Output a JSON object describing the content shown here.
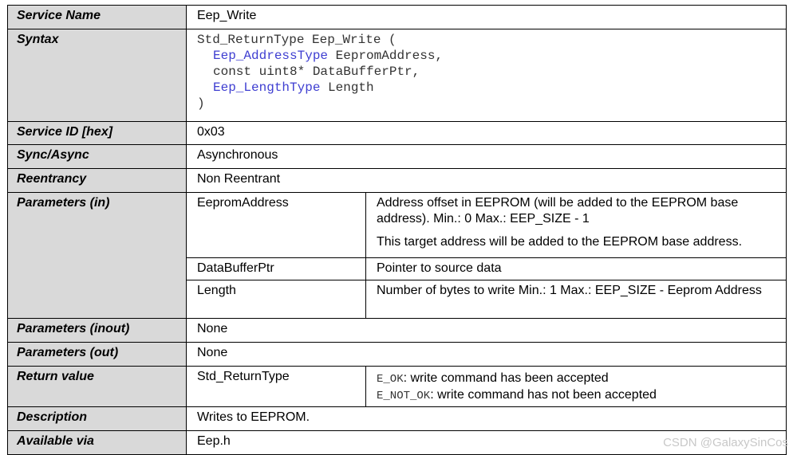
{
  "rows": {
    "service_name": {
      "label": "Service Name",
      "value": "Eep_Write"
    },
    "syntax": {
      "label": "Syntax",
      "line1": "Std_ReturnType Eep_Write (",
      "p1_type": "Eep_AddressType",
      "p1_name": " EepromAddress,",
      "p2": "const uint8* DataBufferPtr,",
      "p3_type": "Eep_LengthType",
      "p3_name": " Length",
      "close": ")"
    },
    "service_id": {
      "label": "Service ID [hex]",
      "value": "0x03"
    },
    "sync": {
      "label": "Sync/Async",
      "value": "Asynchronous"
    },
    "reentrancy": {
      "label": "Reentrancy",
      "value": "Non Reentrant"
    },
    "params_in": {
      "label": "Parameters (in)",
      "items": [
        {
          "name": "EepromAddress",
          "desc": "Address offset in EEPROM (will be added to the EEPROM base address). Min.: 0 Max.: EEP_SIZE - 1",
          "desc2": "This target address will be added to the EEPROM base address."
        },
        {
          "name": "DataBufferPtr",
          "desc": "Pointer to source data"
        },
        {
          "name": "Length",
          "desc": "Number of bytes to write Min.: 1 Max.: EEP_SIZE - Eeprom Address"
        }
      ]
    },
    "params_inout": {
      "label": "Parameters (inout)",
      "value": "None"
    },
    "params_out": {
      "label": "Parameters (out)",
      "value": "None"
    },
    "return_value": {
      "label": "Return value",
      "type": "Std_ReturnType",
      "ok_code": "E_OK",
      "ok_text": ": write command has been accepted",
      "notok_code": "E_NOT_OK",
      "notok_text": ": write command has not been accepted"
    },
    "description": {
      "label": "Description",
      "value": "Writes to EEPROM."
    },
    "available_via": {
      "label": "Available via",
      "value": "Eep.h"
    }
  },
  "watermark": "CSDN @GalaxySinCos"
}
